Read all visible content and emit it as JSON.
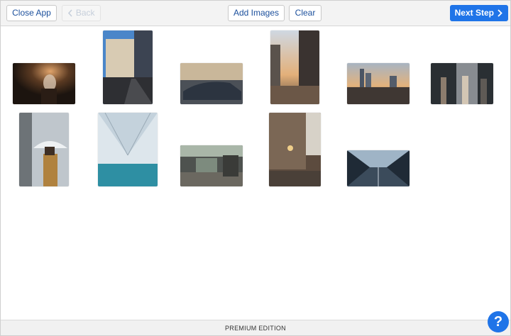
{
  "toolbar": {
    "close_label": "Close App",
    "back_label": "Back",
    "back_icon": "chevron-left-icon",
    "add_images_label": "Add Images",
    "clear_label": "Clear",
    "next_label": "Next Step",
    "next_icon": "chevron-right-icon"
  },
  "photos": [
    {
      "name": "photo-person-flowers-dark"
    },
    {
      "name": "photo-city-street-building"
    },
    {
      "name": "photo-car-street"
    },
    {
      "name": "photo-sunset-street-buildings"
    },
    {
      "name": "photo-city-skyline-sunset"
    },
    {
      "name": "photo-people-shop"
    },
    {
      "name": "photo-person-umbrella"
    },
    {
      "name": "photo-glass-canopy-pool"
    },
    {
      "name": "photo-market-street"
    },
    {
      "name": "photo-alley-cafe"
    },
    {
      "name": "photo-glass-walkway"
    }
  ],
  "footer": {
    "edition": "PREMIUM EDITION"
  },
  "help": {
    "label": "?",
    "icon": "question-icon"
  },
  "colors": {
    "accent": "#1f74e8",
    "toolbar_bg": "#f3f3f3",
    "footer_bg": "#f1f1f1",
    "link_text": "#1b4f9c"
  }
}
